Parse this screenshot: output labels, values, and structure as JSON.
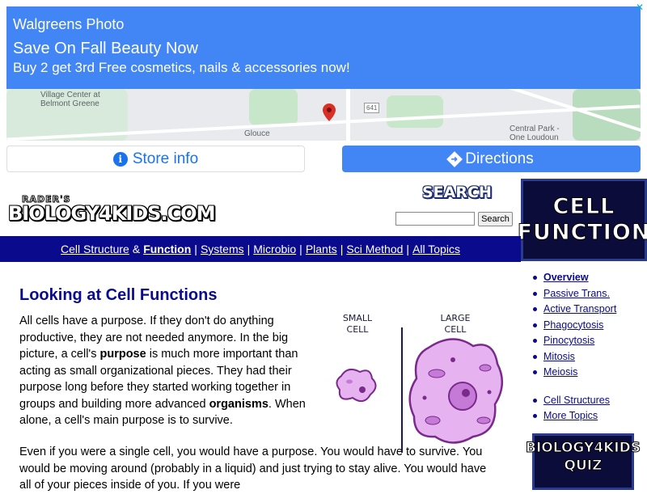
{
  "ad": {
    "brand": "Walgreens Photo",
    "headline": "Save On Fall Beauty Now",
    "description": "Buy 2 get 3rd Free cosmetics, nails & accessories now!",
    "adchoices": "✕",
    "map_labels": {
      "village": "Village Center at",
      "belmont": "Belmont Greene",
      "central": "Central Park -",
      "loudoun": "One Loudoun",
      "road_641": "641",
      "gloucester": "Glouce"
    },
    "store_info_label": "Store info",
    "directions_label": "Directions",
    "brand_color": "#4285f4"
  },
  "site": {
    "logo_top": "RADER'S",
    "logo": "BIOLOGY4KIDS.COM",
    "search_title": "SEARCH",
    "search_placeholder": "",
    "search_button": "Search",
    "cell_box_line1": "CELL",
    "cell_box_line2": "FUNCTION"
  },
  "nav": {
    "cell_structure": "Cell Structure",
    "amp": "&",
    "function": "Function",
    "systems": "Systems",
    "microbio": "Microbio",
    "plants": "Plants",
    "sci_method": "Sci Method",
    "all_topics": "All Topics",
    "sep": "|"
  },
  "main": {
    "title": "Looking at Cell Functions",
    "p1_a": "All cells have a purpose. If they don't do anything productive, they are not needed anymore. In the big picture, a cell's ",
    "p1_b": "purpose",
    "p1_c": " is much more important than acting as small organizational pieces. They had their purpose long before they started working together in groups and building more advanced ",
    "p1_d": "organisms",
    "p1_e": ". When alone, a cell's main purpose is to survive.",
    "p2": "Even if you were a single cell, you would have a purpose. You would have to survive. You would be moving around (probably in a liquid) and just trying to stay alive. You would have all of your pieces inside of you. If you were"
  },
  "diagram": {
    "small_l1": "SMALL",
    "small_l2": "CELL",
    "large_l1": "LARGE",
    "large_l2": "CELL"
  },
  "sidebar": {
    "items": [
      {
        "label": "Overview"
      },
      {
        "label": "Passive Trans."
      },
      {
        "label": "Active Transport"
      },
      {
        "label": "Phagocytosis"
      },
      {
        "label": "Pinocytosis"
      },
      {
        "label": "Mitosis"
      },
      {
        "label": "Meiosis"
      }
    ],
    "items2": [
      {
        "label": "Cell Structures"
      },
      {
        "label": "More Topics"
      }
    ],
    "quiz_l1": "BIOLOGY4KIDS",
    "quiz_l2": "QUIZ"
  }
}
